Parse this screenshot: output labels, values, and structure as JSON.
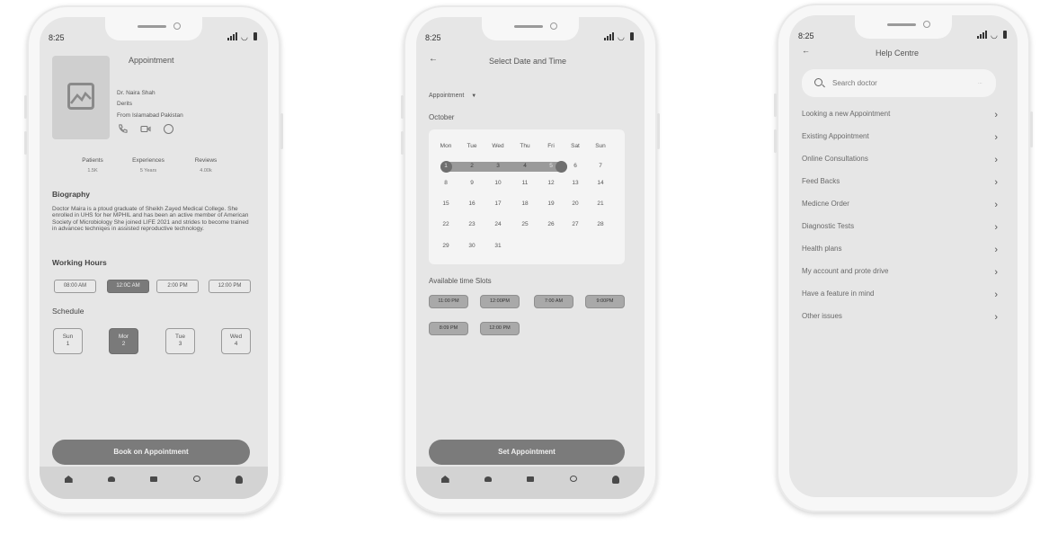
{
  "status": {
    "time": "8:25"
  },
  "profile": {
    "title": "Appointment",
    "doctor_name": "Dr. Naira Shah",
    "specialty": "Derits",
    "location": "From Islamabad Pakistan",
    "stats": [
      {
        "label": "Patients",
        "value": "1.5K"
      },
      {
        "label": "Experiences",
        "value": "5 Years"
      },
      {
        "label": "Reviews",
        "value": "4.00k"
      }
    ],
    "biography_heading": "Biography",
    "biography": "Doctor Maira is a ptoud graduate of Sheikh Zayed Medical College. She enrolled in UHS for her MPHIL and has been an active member of American Society of Microbiology She joined LIFE 2021 and strides to become trained in advancec techniqes in assisted reproductive technology.",
    "working_hours_heading": "Working Hours",
    "working_hours": [
      "08:00 AM",
      "12:0C AM",
      "2:00 PM",
      "12:00 PM"
    ],
    "schedule_heading": "Schedule",
    "schedule": [
      {
        "day": "Sun",
        "date": "1"
      },
      {
        "day": "Mor",
        "date": "2"
      },
      {
        "day": "Tue",
        "date": "3"
      },
      {
        "day": "Wed",
        "date": "4"
      }
    ],
    "cta": "Book on Appointment"
  },
  "date_time": {
    "title": "Select Date and Time",
    "dropdown": "Appointment",
    "month": "October",
    "weekdays": [
      "Mon",
      "Tue",
      "Wed",
      "Thu",
      "Fri",
      "Sat",
      "Sun"
    ],
    "weeks": [
      [
        "1",
        "2",
        "3",
        "4",
        "5",
        "6",
        "7"
      ],
      [
        "8",
        "9",
        "10",
        "11",
        "12",
        "13",
        "14"
      ],
      [
        "15",
        "16",
        "17",
        "18",
        "19",
        "20",
        "21"
      ],
      [
        "22",
        "23",
        "24",
        "25",
        "26",
        "27",
        "28"
      ],
      [
        "29",
        "30",
        "31",
        "",
        "",
        "",
        ""
      ]
    ],
    "slots_heading": "Available time Slots",
    "slots": [
      "11:00 PM",
      "12:00PM",
      "7:00 AM",
      "9:00PM",
      "8:09 PM",
      "12:00 PM"
    ],
    "cta": "Set Appointment"
  },
  "help": {
    "title": "Help Centre",
    "search_placeholder": "Search doctor",
    "items": [
      "Looking a new Appointment",
      "Existing Appointment",
      "Online Consultations",
      "Feed Backs",
      "Medicne Order",
      "Diagnostic Tests",
      "Health plans",
      "My account and prote drive",
      "Have a feature in mind",
      "Other issues"
    ]
  }
}
